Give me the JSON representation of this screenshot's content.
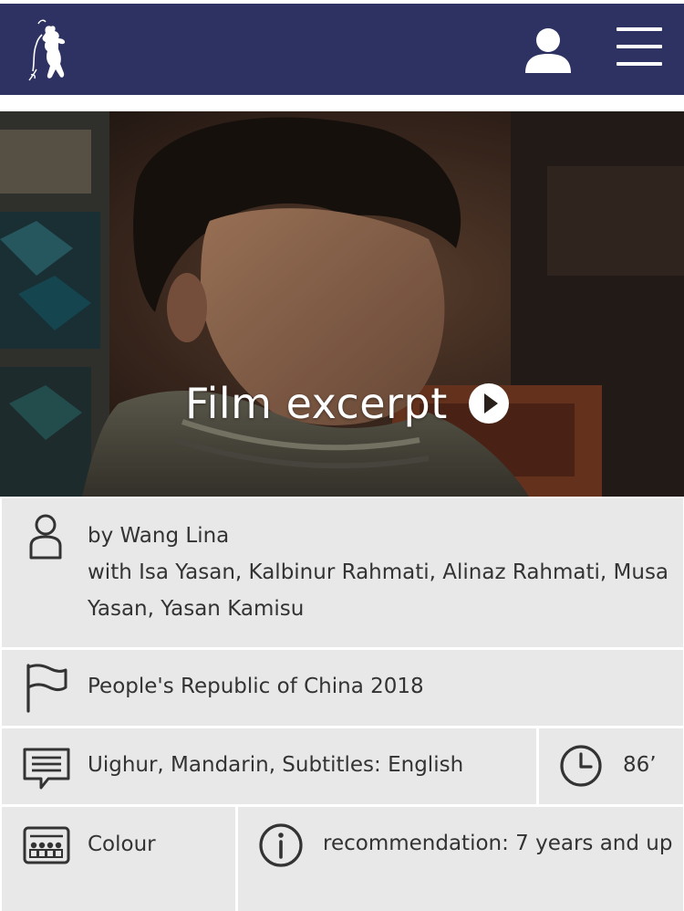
{
  "header": {
    "logo_icon": "berlinale-bear-logo",
    "user_icon": "user-icon",
    "menu_icon": "hamburger-menu-icon",
    "background": "#2e3262"
  },
  "hero": {
    "label": "Film excerpt",
    "play_icon": "play-circle-icon"
  },
  "details": {
    "credits": {
      "icon": "person-icon",
      "director": "by Wang Lina",
      "cast_line1": "with Isa Yasan, Kalbinur Rahmati, Alinaz Rahmati, Musa",
      "cast_line2": "Yasan, Yasan Kamisu"
    },
    "origin": {
      "icon": "flag-icon",
      "text": "People's Republic of China 2018"
    },
    "languages": {
      "icon": "subtitles-speech-icon",
      "text": "Uighur,  Mandarin,  Subtitles: English"
    },
    "duration": {
      "icon": "clock-icon",
      "text": "86’"
    },
    "color": {
      "icon": "cinema-seats-icon",
      "text": "Colour"
    },
    "recommendation": {
      "icon": "info-icon",
      "text": "recommendation: 7 years and up"
    }
  }
}
